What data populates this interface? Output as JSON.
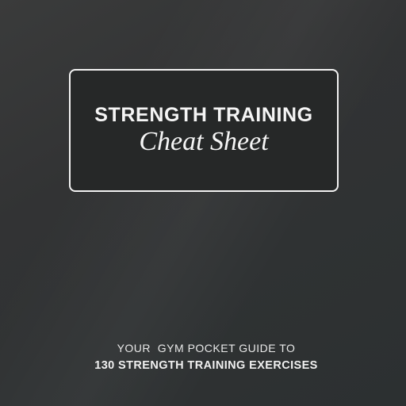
{
  "cover": {
    "title": "STRENGTH TRAINING",
    "script_title": "Cheat Sheet",
    "tagline_line1": "YOUR  GYM POCKET GUIDE TO",
    "tagline_line2": "130 STRENGTH TRAINING EXERCISES"
  },
  "colors": {
    "background": "#323334",
    "title_box": "#262828",
    "text": "#f5f5f5"
  }
}
